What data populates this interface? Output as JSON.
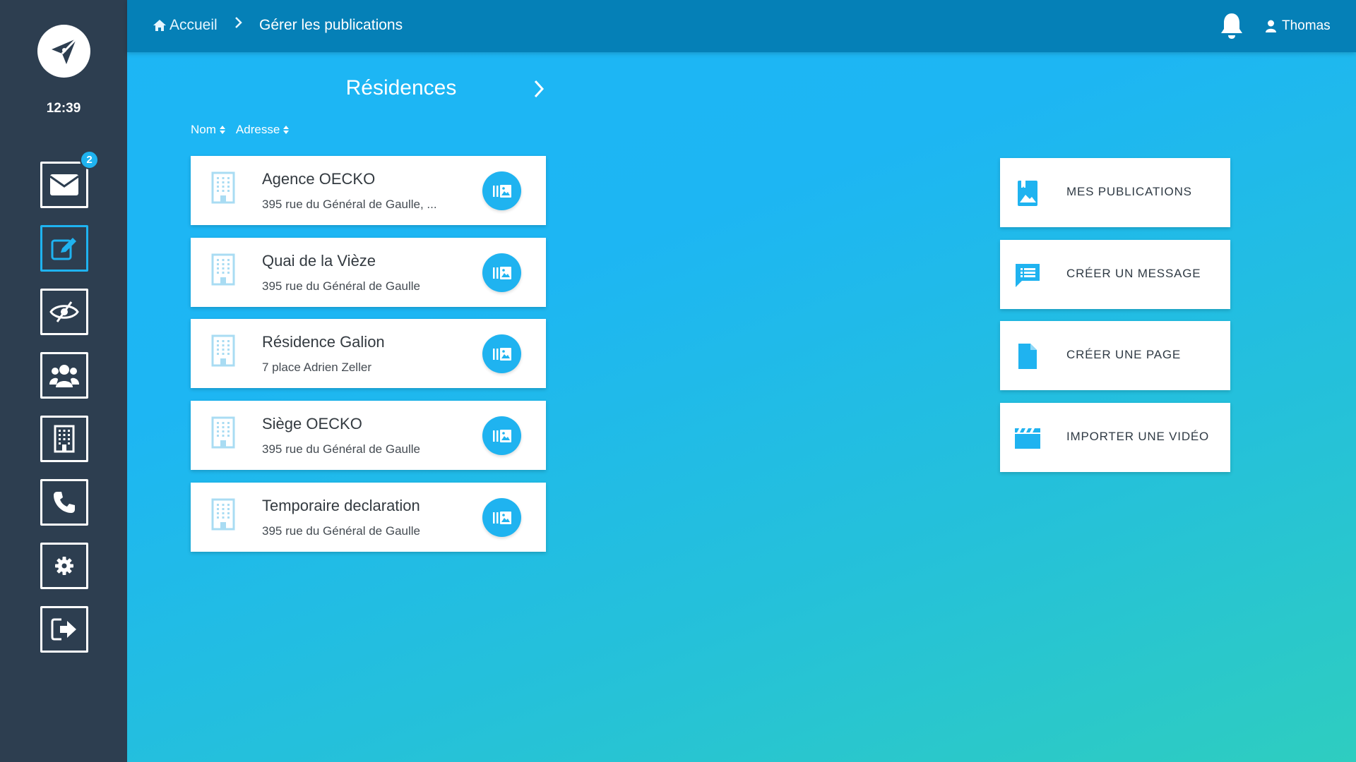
{
  "sidebar": {
    "time": "12:39",
    "messages_badge": "2",
    "items": [
      {
        "name": "mail",
        "icon": "envelope-icon"
      },
      {
        "name": "edit",
        "icon": "edit-icon",
        "active": true
      },
      {
        "name": "visibility",
        "icon": "eye-slash-icon"
      },
      {
        "name": "users",
        "icon": "users-icon"
      },
      {
        "name": "residences",
        "icon": "building-icon"
      },
      {
        "name": "phone",
        "icon": "phone-icon"
      },
      {
        "name": "settings",
        "icon": "gear-icon"
      },
      {
        "name": "logout",
        "icon": "sign-out-icon"
      }
    ]
  },
  "header": {
    "home_label": "Accueil",
    "separator": ">",
    "current_label": "Gérer les publications",
    "user_name": "Thomas"
  },
  "residences": {
    "title": "Résidences",
    "sort_name": "Nom",
    "sort_address": "Adresse",
    "items": [
      {
        "name": "Agence OECKO",
        "address": "395 rue du Général de Gaulle, ..."
      },
      {
        "name": "Quai de la Vièze",
        "address": "395 rue du Général de Gaulle"
      },
      {
        "name": "Résidence Galion",
        "address": "7 place Adrien Zeller"
      },
      {
        "name": "Siège OECKO",
        "address": "395 rue du Général de Gaulle"
      },
      {
        "name": "Temporaire declaration",
        "address": "395 rue du Général de Gaulle"
      }
    ]
  },
  "actions": [
    {
      "label": "MES PUBLICATIONS",
      "icon": "publication-icon"
    },
    {
      "label": "CRÉER UN MESSAGE",
      "icon": "message-icon"
    },
    {
      "label": "CRÉER UNE PAGE",
      "icon": "page-icon"
    },
    {
      "label": "IMPORTER UNE VIDÉO",
      "icon": "video-icon"
    }
  ],
  "colors": {
    "sidebar_bg": "#2d3e50",
    "topbar_bg": "#0580b7",
    "accent": "#1fb3f0",
    "gradient_start": "#1db6f5",
    "gradient_end": "#2ecdc0"
  }
}
